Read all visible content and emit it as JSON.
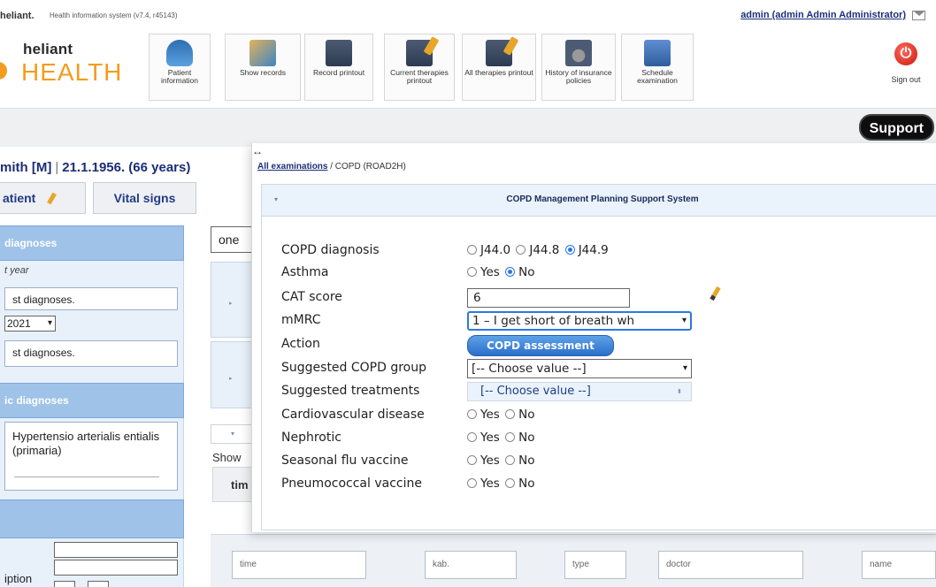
{
  "topbar": {
    "brand_mini": "heliant.",
    "system_name": "Health information system (v7.4, r45143)",
    "admin_link": "admin (admin Admin Administrator)"
  },
  "logo": {
    "line1": "heliant",
    "line2": "HEALTH"
  },
  "toolbar": [
    {
      "id": "patient",
      "label": "Patient information",
      "icon": "patient-icon"
    },
    {
      "id": "records",
      "label": "Show records",
      "icon": "records-icon"
    },
    {
      "id": "rprint",
      "label": "Record printout",
      "icon": "record-print-icon"
    },
    {
      "id": "ctherapy",
      "label": "Current therapies printout",
      "icon": "current-therapy-icon"
    },
    {
      "id": "atherapy",
      "label": "All therapies printout",
      "icon": "all-therapy-icon"
    },
    {
      "id": "history",
      "label": "History of insurance policies",
      "icon": "insurance-history-icon"
    },
    {
      "id": "schedule",
      "label": "Schedule examination",
      "icon": "schedule-icon"
    }
  ],
  "signout_label": "Sign out",
  "support_label": "Support",
  "patient": {
    "name": "mith [M]",
    "separator": "|",
    "dob": "21.1.1956. (66 years)"
  },
  "tabs": {
    "patient": "atient",
    "vital": "Vital signs"
  },
  "left": {
    "panel1_title": "diagnoses",
    "year_label": "t year",
    "last_diagnoses_1": "st diagnoses.",
    "year_select": "2021",
    "last_diagnoses_2": "st diagnoses.",
    "panel2_title": "ic diagnoses",
    "diagnosis_text": "Hypertensio arterialis entialis (primaria)",
    "description_label": "iption"
  },
  "middle": {
    "select_value": "one",
    "show_label": "Show",
    "col_header": "tim"
  },
  "filters": {
    "time": "time",
    "kab": "kab.",
    "type": "type",
    "doctor": "doctor",
    "name": "name"
  },
  "modal": {
    "resize_glyph": "↔",
    "crumb_link": "All examinations",
    "crumb_rest": " / COPD (ROAD2H)",
    "panel_title": "COPD Management Planning Support System",
    "fields": {
      "copd_diagnosis": {
        "label": "COPD diagnosis",
        "options": [
          "J44.0",
          "J44.8",
          "J44.9"
        ],
        "selected": "J44.9"
      },
      "asthma": {
        "label": "Asthma",
        "options": [
          "Yes",
          "No"
        ],
        "selected": "No"
      },
      "cat_score": {
        "label": "CAT score",
        "value": "6"
      },
      "mmrc": {
        "label": "mMRC",
        "value": "1 – I get short of breath wh"
      },
      "action": {
        "label": "Action",
        "button": "COPD assessment"
      },
      "suggested_group": {
        "label": "Suggested COPD group",
        "value": "[-- Choose value --]"
      },
      "suggested_treatments": {
        "label": "Suggested treatments",
        "value": "[-- Choose value --]"
      },
      "cardio": {
        "label": "Cardiovascular disease",
        "options": [
          "Yes",
          "No"
        ],
        "selected": ""
      },
      "nephrotic": {
        "label": "Nephrotic",
        "options": [
          "Yes",
          "No"
        ],
        "selected": ""
      },
      "flu": {
        "label": "Seasonal flu vaccine",
        "options": [
          "Yes",
          "No"
        ],
        "selected": ""
      },
      "pneumo": {
        "label": "Pneumococcal vaccine",
        "options": [
          "Yes",
          "No"
        ],
        "selected": ""
      }
    }
  }
}
